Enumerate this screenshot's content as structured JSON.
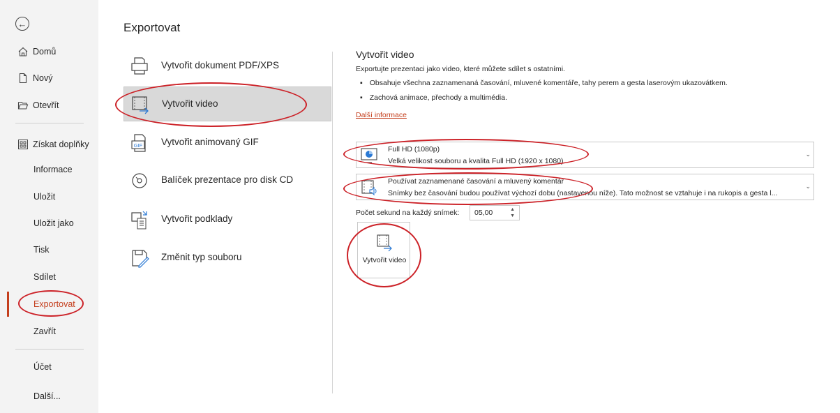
{
  "nav": {
    "back_icon": "back-arrow-icon",
    "items": [
      {
        "label": "Domů",
        "icon": "home-icon"
      },
      {
        "label": "Nový",
        "icon": "new-document-icon"
      },
      {
        "label": "Otevřít",
        "icon": "folder-open-icon"
      },
      {
        "label": "Získat doplňky",
        "icon": "addins-icon"
      },
      {
        "label": "Informace"
      },
      {
        "label": "Uložit"
      },
      {
        "label": "Uložit jako"
      },
      {
        "label": "Tisk"
      },
      {
        "label": "Sdílet"
      },
      {
        "label": "Exportovat"
      },
      {
        "label": "Zavřít"
      },
      {
        "label": "Účet"
      },
      {
        "label": "Další..."
      }
    ]
  },
  "page_title": "Exportovat",
  "options": [
    {
      "label": "Vytvořit dokument PDF/XPS",
      "icon": "pdf-xps-icon"
    },
    {
      "label": "Vytvořit video",
      "icon": "video-icon"
    },
    {
      "label": "Vytvořit animovaný GIF",
      "icon": "gif-icon"
    },
    {
      "label": "Balíček prezentace pro disk CD",
      "icon": "cd-icon"
    },
    {
      "label": "Vytvořit podklady",
      "icon": "handouts-icon"
    },
    {
      "label": "Změnit typ souboru",
      "icon": "change-file-type-icon"
    }
  ],
  "panel": {
    "title": "Vytvořit video",
    "description": "Exportujte prezentaci jako video, které můžete sdílet s ostatními.",
    "bullets": [
      "Obsahuje všechna zaznamenaná časování, mluvené komentáře, tahy perem a gesta laserovým ukazovátkem.",
      "Zachová animace, přechody a multimédia."
    ],
    "link": "Další informace",
    "quality": {
      "title": "Full HD (1080p)",
      "subtitle": "Velká velikost souboru a kvalita Full HD (1920 x 1080)"
    },
    "timing": {
      "title": "Používat zaznamenané časování a mluvený komentář",
      "subtitle": "Snímky bez časování budou používat výchozí dobu (nastavenou níže). Tato možnost se vztahuje i na rukopis a gesta l..."
    },
    "seconds_label": "Počet sekund na každý snímek:",
    "seconds_value": "05,00",
    "create_button": "Vytvořit video"
  },
  "colors": {
    "accent": "#c43e1c",
    "annotation": "#cc2127",
    "nav_bg": "#f3f3f3",
    "selected_bg": "#d9d9d9"
  }
}
